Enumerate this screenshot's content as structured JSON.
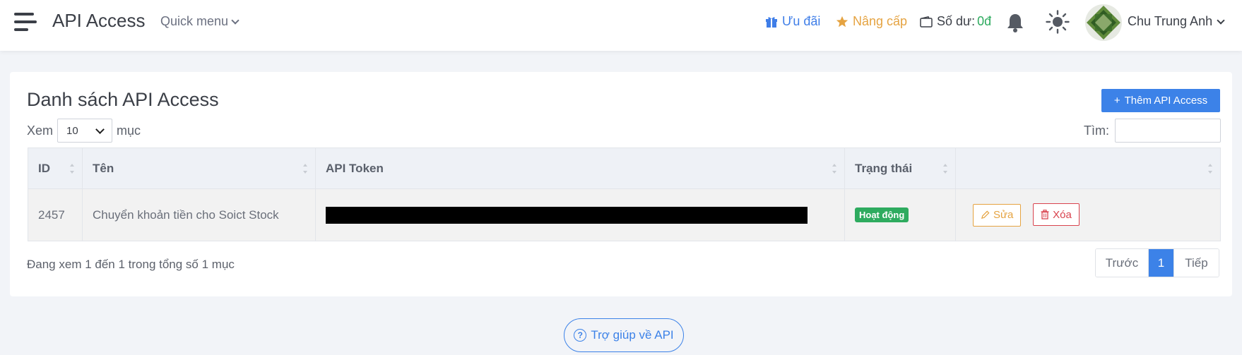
{
  "header": {
    "title": "API Access",
    "quick_menu": "Quick menu",
    "promo": "Ưu đãi",
    "upgrade": "Nâng cấp",
    "balance_label": "Số dư:",
    "balance_value": "0đ",
    "user_name": "Chu Trung Anh"
  },
  "card": {
    "title": "Danh sách API Access",
    "add_button": "Thêm API Access",
    "length_prefix": "Xem",
    "length_value": "10",
    "length_suffix": "mục",
    "search_label": "Tìm:",
    "search_value": ""
  },
  "table": {
    "columns": [
      "ID",
      "Tên",
      "API Token",
      "Trạng thái",
      ""
    ],
    "rows": [
      {
        "id": "2457",
        "name": "Chuyển khoản tiền cho Soict Stock",
        "token": "",
        "status": "Hoạt động",
        "edit": "Sửa",
        "delete": "Xóa"
      }
    ]
  },
  "footer": {
    "info": "Đang xem 1 đến 1 trong tổng số 1 mục",
    "prev": "Trước",
    "page": "1",
    "next": "Tiếp"
  },
  "help_button": "Trợ giúp về API",
  "colors": {
    "primary": "#3c82e8",
    "success": "#2eab5f",
    "warning": "#e5a341",
    "danger": "#d9434e"
  }
}
